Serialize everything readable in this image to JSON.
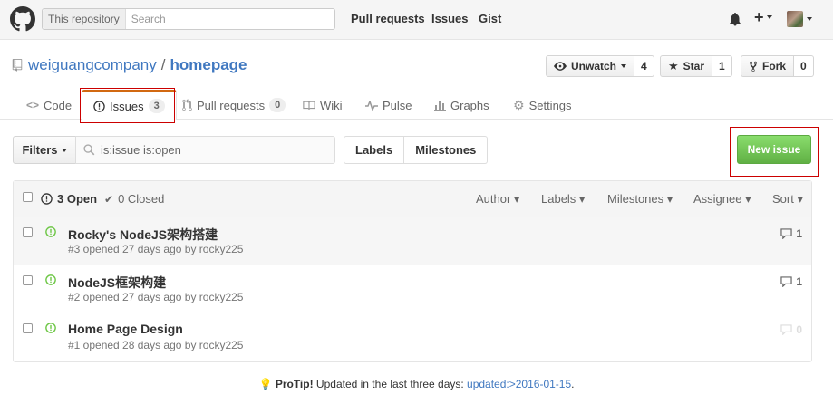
{
  "header": {
    "search_scope": "This repository",
    "search_placeholder": "Search",
    "nav": [
      "Pull requests",
      "Issues",
      "Gist"
    ]
  },
  "repo": {
    "owner": "weiguangcompany",
    "separator": "/",
    "name": "homepage",
    "watch_label": "Unwatch",
    "watch_count": "4",
    "star_label": "Star",
    "star_count": "1",
    "fork_label": "Fork",
    "fork_count": "0"
  },
  "tabs": [
    {
      "label": "Code"
    },
    {
      "label": "Issues",
      "counter": "3"
    },
    {
      "label": "Pull requests",
      "counter": "0"
    },
    {
      "label": "Wiki"
    },
    {
      "label": "Pulse"
    },
    {
      "label": "Graphs"
    },
    {
      "label": "Settings"
    }
  ],
  "filter": {
    "filters_label": "Filters",
    "query": "is:issue is:open",
    "labels_label": "Labels",
    "milestones_label": "Milestones",
    "new_issue_label": "New issue"
  },
  "list_header": {
    "open_label": "3 Open",
    "closed_label": "0 Closed",
    "sorts": [
      "Author",
      "Labels",
      "Milestones",
      "Assignee",
      "Sort"
    ]
  },
  "issues": [
    {
      "title": "Rocky's NodeJS架构搭建",
      "meta": "#3 opened 27 days ago by rocky225",
      "comments": "1"
    },
    {
      "title": "NodeJS框架构建",
      "meta": "#2 opened 27 days ago by rocky225",
      "comments": "1"
    },
    {
      "title": "Home Page Design",
      "meta": "#1 opened 28 days ago by rocky225",
      "comments": "0"
    }
  ],
  "protip": {
    "bold": "ProTip!",
    "text": " Updated in the last three days: ",
    "link": "updated:>2016-01-15",
    "end": "."
  },
  "colors": {
    "link": "#4078c0",
    "accent_tab": "#d26911",
    "new_issue_green": "#60b044",
    "open_green": "#6cc644",
    "annotation_red": "#cc0000"
  }
}
